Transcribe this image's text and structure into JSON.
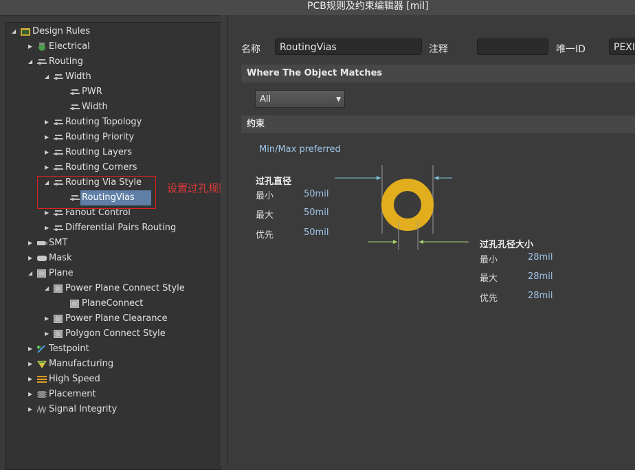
{
  "window": {
    "title": "PCB规则及约束编辑器 [mil]"
  },
  "tree": {
    "root": "Design Rules",
    "electrical": "Electrical",
    "routing": "Routing",
    "width": "Width",
    "pwr": "PWR",
    "width_rule": "Width",
    "routing_topology": "Routing Topology",
    "routing_priority": "Routing Priority",
    "routing_layers": "Routing Layers",
    "routing_corners": "Routing Corners",
    "routing_via_style": "Routing Via Style",
    "routingvias": "RoutingVias",
    "fanout_control": "Fanout Control",
    "diff_pairs": "Differential Pairs Routing",
    "smt": "SMT",
    "mask": "Mask",
    "plane": "Plane",
    "power_plane_connect": "Power Plane Connect Style",
    "planeconnect": "PlaneConnect",
    "power_plane_clearance": "Power Plane Clearance",
    "polygon_connect": "Polygon Connect Style",
    "testpoint": "Testpoint",
    "manufacturing": "Manufacturing",
    "high_speed": "High Speed",
    "placement": "Placement",
    "signal_integrity": "Signal Integrity"
  },
  "annotation": {
    "text": "设置过孔规则",
    "color": "#e02020"
  },
  "form": {
    "name_label": "名称",
    "name_value": "RoutingVias",
    "comment_label": "注释",
    "comment_value": "",
    "uid_label": "唯一ID",
    "uid_value": "PEXIV"
  },
  "where_matches": {
    "title": "Where The Object Matches",
    "selected": "All"
  },
  "constraints": {
    "title": "约束",
    "mode": "Min/Max preferred",
    "via_diameter": {
      "title": "过孔直径",
      "min_label": "最小",
      "min": "50mil",
      "max_label": "最大",
      "max": "50mil",
      "pref_label": "优先",
      "pref": "50mil"
    },
    "hole_size": {
      "title": "过孔孔径大小",
      "min_label": "最小",
      "min": "28mil",
      "max_label": "最大",
      "max": "28mil",
      "pref_label": "优先",
      "pref": "28mil"
    }
  },
  "colors": {
    "via_ring": "#e3ae1e",
    "selection": "#5f7fa6",
    "value_text": "#9ec3e6"
  }
}
